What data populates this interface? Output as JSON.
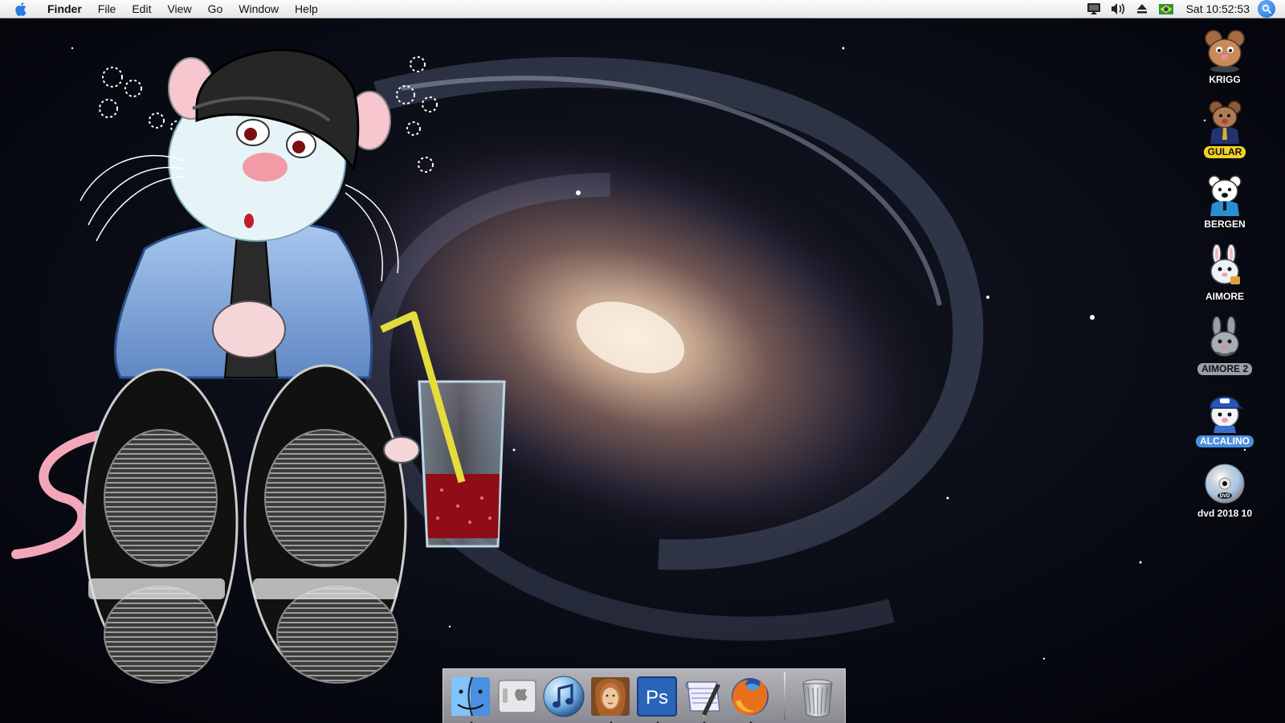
{
  "menubar": {
    "apple_icon": "apple-icon",
    "app_name": "Finder",
    "menus": [
      "File",
      "Edit",
      "View",
      "Go",
      "Window",
      "Help"
    ],
    "status_icons": [
      "display-icon",
      "volume-icon",
      "eject-icon",
      "brazil-flag-icon"
    ],
    "clock": "Sat 10:52:53",
    "spotlight_icon": "spotlight-search-icon"
  },
  "desktop": {
    "icons": [
      {
        "label": "KRIGG",
        "style": "plain",
        "icon": "brown-mouse-icon"
      },
      {
        "label": "GULAR",
        "style": "yellow",
        "icon": "mouse-in-suit-icon"
      },
      {
        "label": "BERGEN",
        "style": "plain",
        "icon": "white-bear-icon"
      },
      {
        "label": "AIMORE",
        "style": "plain",
        "icon": "white-rabbit-icon"
      },
      {
        "label": "AIMORE 2",
        "style": "gray",
        "icon": "gray-rabbit-icon"
      },
      {
        "label": "ALCALINO",
        "style": "blue",
        "icon": "mouse-with-cap-icon"
      },
      {
        "label": "dvd 2018 10",
        "style": "plain",
        "icon": "dvd-disc-icon"
      }
    ]
  },
  "dock": {
    "items": [
      {
        "name": "finder",
        "icon": "finder-icon",
        "running": true
      },
      {
        "name": "system-preferences",
        "icon": "apple-switch-icon",
        "running": false
      },
      {
        "name": "itunes",
        "icon": "itunes-icon",
        "running": false
      },
      {
        "name": "painter",
        "icon": "painter-portrait-icon",
        "running": true
      },
      {
        "name": "photoshop",
        "label": "Ps",
        "icon": "photoshop-icon",
        "running": true
      },
      {
        "name": "script-editor",
        "icon": "script-editor-icon",
        "running": true
      },
      {
        "name": "firefox",
        "icon": "firefox-icon",
        "running": true
      }
    ],
    "trash_icon": "trash-icon"
  }
}
